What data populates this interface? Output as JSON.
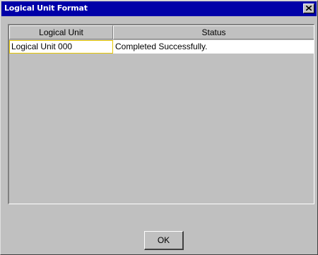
{
  "window": {
    "title": "Logical Unit Format",
    "title_color": "#ffffff",
    "titlebar_color": "#0000a8"
  },
  "table": {
    "columns": [
      "Logical Unit",
      "Status"
    ],
    "rows": [
      [
        "Logical Unit 000",
        "Completed Successfully."
      ]
    ],
    "selected_cell_border_color": "#e8c800"
  },
  "buttons": {
    "ok_label": "OK",
    "close_icon": "close-icon"
  }
}
